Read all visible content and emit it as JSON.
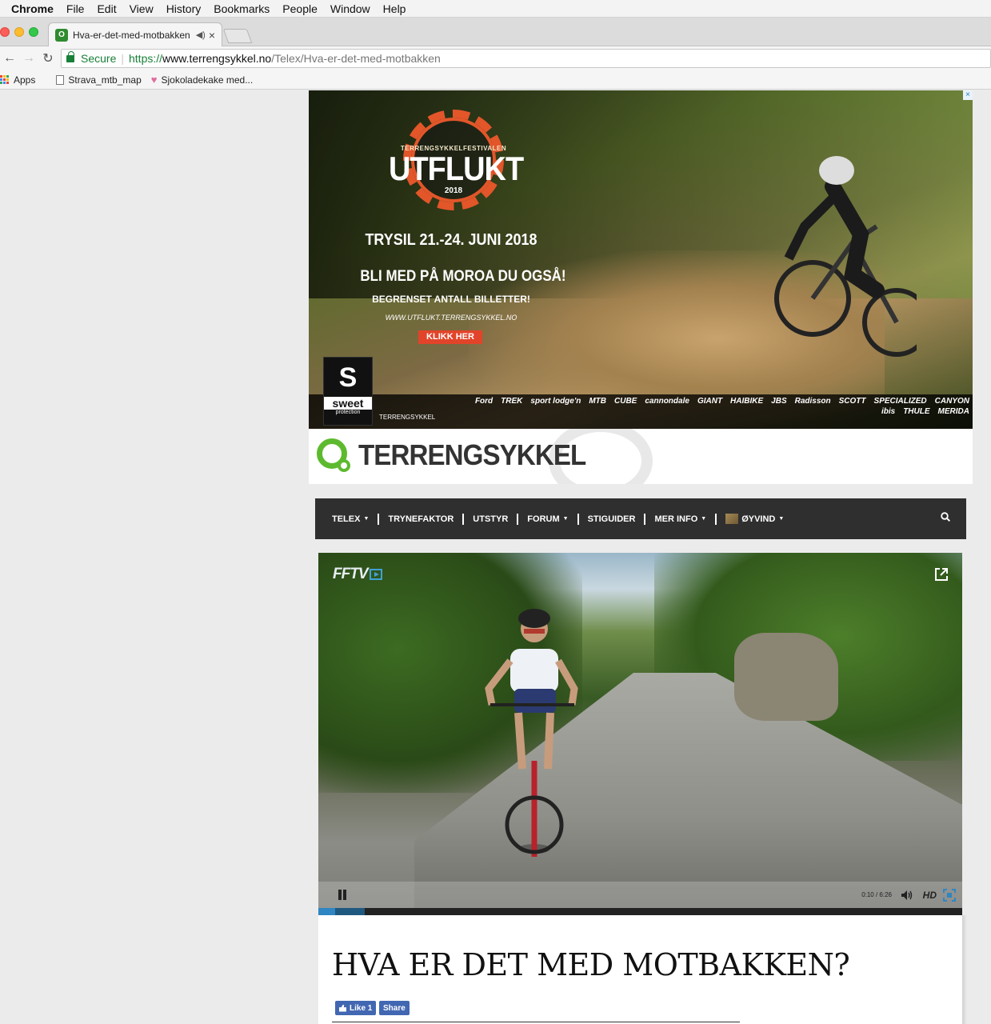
{
  "menubar": {
    "app": "Chrome",
    "items": [
      "File",
      "Edit",
      "View",
      "History",
      "Bookmarks",
      "People",
      "Window",
      "Help"
    ]
  },
  "tab": {
    "title": "Hva-er-det-med-motbakken",
    "favicon_label": "O"
  },
  "address": {
    "secure_label": "Secure",
    "scheme": "https://",
    "host": "www.terrengsykkel.no",
    "path": "/Telex/Hva-er-det-med-motbakken"
  },
  "bookmarks": {
    "items": [
      "Apps",
      "Strava_mtb_map",
      "Sjokoladekake med..."
    ]
  },
  "ad": {
    "close": "×",
    "festival": "TERRENGSYKKELFESTIVALEN",
    "name": "UTFLUKT",
    "year": "2018",
    "date": "TRYSIL 21.-24. JUNI 2018",
    "tagline": "BLI MED PÅ MOROA DU OGSÅ!",
    "limited": "BEGRENSET ANTALL BILLETTER!",
    "url": "WWW.UTFLUKT.TERRENGSYKKEL.NO",
    "cta": "KLIKK HER",
    "sweet": "sweet",
    "sweet_sub": "protection",
    "terrengsykkel_small": "TERRENGSYKKEL",
    "sponsors": [
      "Ford",
      "TREK",
      "sport lodge'n",
      "MTB",
      "CUBE",
      "cannondale",
      "GIANT",
      "HAIBIKE",
      "JBS",
      "Radisson",
      "SCOTT",
      "SPECIALIZED",
      "CANYON",
      "ibis",
      "THULE",
      "MERIDA"
    ]
  },
  "site": {
    "logo_text": "TERRENGSYKKEL"
  },
  "nav": {
    "items": [
      {
        "label": "TELEX",
        "dropdown": true
      },
      {
        "label": "TRYNEFAKTOR",
        "dropdown": false
      },
      {
        "label": "UTSTYR",
        "dropdown": false
      },
      {
        "label": "FORUM",
        "dropdown": true
      },
      {
        "label": "STIGUIDER",
        "dropdown": false
      },
      {
        "label": "MER INFO",
        "dropdown": true
      }
    ],
    "user": "ØYVIND",
    "caret": "▼"
  },
  "video": {
    "brand": "FFTV",
    "time": "0:10 / 6:26",
    "hd": "HD",
    "progress_played": 0.026,
    "progress_buffered": 0.072
  },
  "article": {
    "title": "HVA ER DET MED MOTBAKKEN?",
    "like_label": "Like 1",
    "share_label": "Share"
  },
  "colors": {
    "nav_bg": "#2f2f2f",
    "brand_green": "#5dba2f",
    "fb_blue": "#4267b2",
    "progress": "#2f86c2",
    "ad_orange": "#e2562a"
  }
}
